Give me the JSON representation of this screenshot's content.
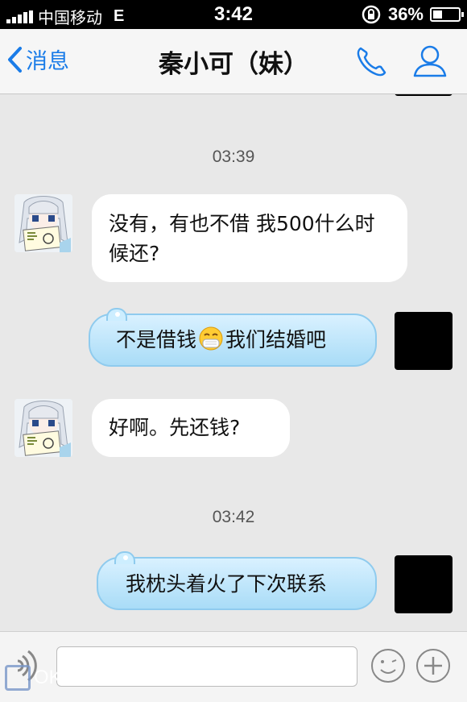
{
  "status_bar": {
    "carrier": "中国移动",
    "network": "E",
    "time": "3:42",
    "battery": "36%",
    "battery_level": 0.36
  },
  "nav": {
    "back_label": "消息",
    "title": "秦小可（妹）",
    "accent": "#1a7ce8"
  },
  "messages": [
    {
      "type": "timestamp",
      "text": "03:39"
    },
    {
      "type": "incoming",
      "text": "没有，有也不借 我500什么时候还?"
    },
    {
      "type": "outgoing",
      "text_before": "不是借钱",
      "emoji": "mask-face-emoji",
      "text_after": "我们结婚吧"
    },
    {
      "type": "incoming",
      "text": "好啊。先还钱?"
    },
    {
      "type": "timestamp",
      "text": "03:42"
    },
    {
      "type": "outgoing",
      "text": "我枕头着火了下次联系"
    }
  ],
  "toolbar": {
    "input_value": "",
    "voice_icon": "voice-icon",
    "emoji_icon": "smiley-icon",
    "plus_icon": "plus-icon"
  },
  "watermark": "OKO.CO"
}
